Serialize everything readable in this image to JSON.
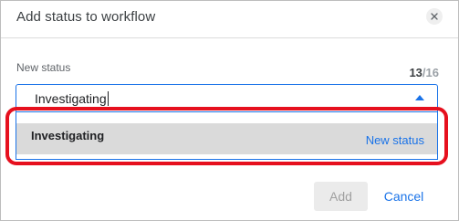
{
  "dialog": {
    "title": "Add status to workflow",
    "close_icon": "close-icon"
  },
  "field": {
    "label": "New status",
    "value": "Investigating",
    "counter_current": "13",
    "counter_separator": "/",
    "counter_max": "16",
    "dropdown_icon": "caret-up-icon"
  },
  "dropdown": {
    "options": [
      {
        "name": "Investigating",
        "tag": "New status",
        "highlighted": true
      }
    ]
  },
  "actions": {
    "add_label": "Add",
    "add_disabled": true,
    "cancel_label": "Cancel"
  },
  "colors": {
    "accent": "#1a73e8",
    "annotation_ring": "#e6101e",
    "option_hover": "#dadada"
  }
}
